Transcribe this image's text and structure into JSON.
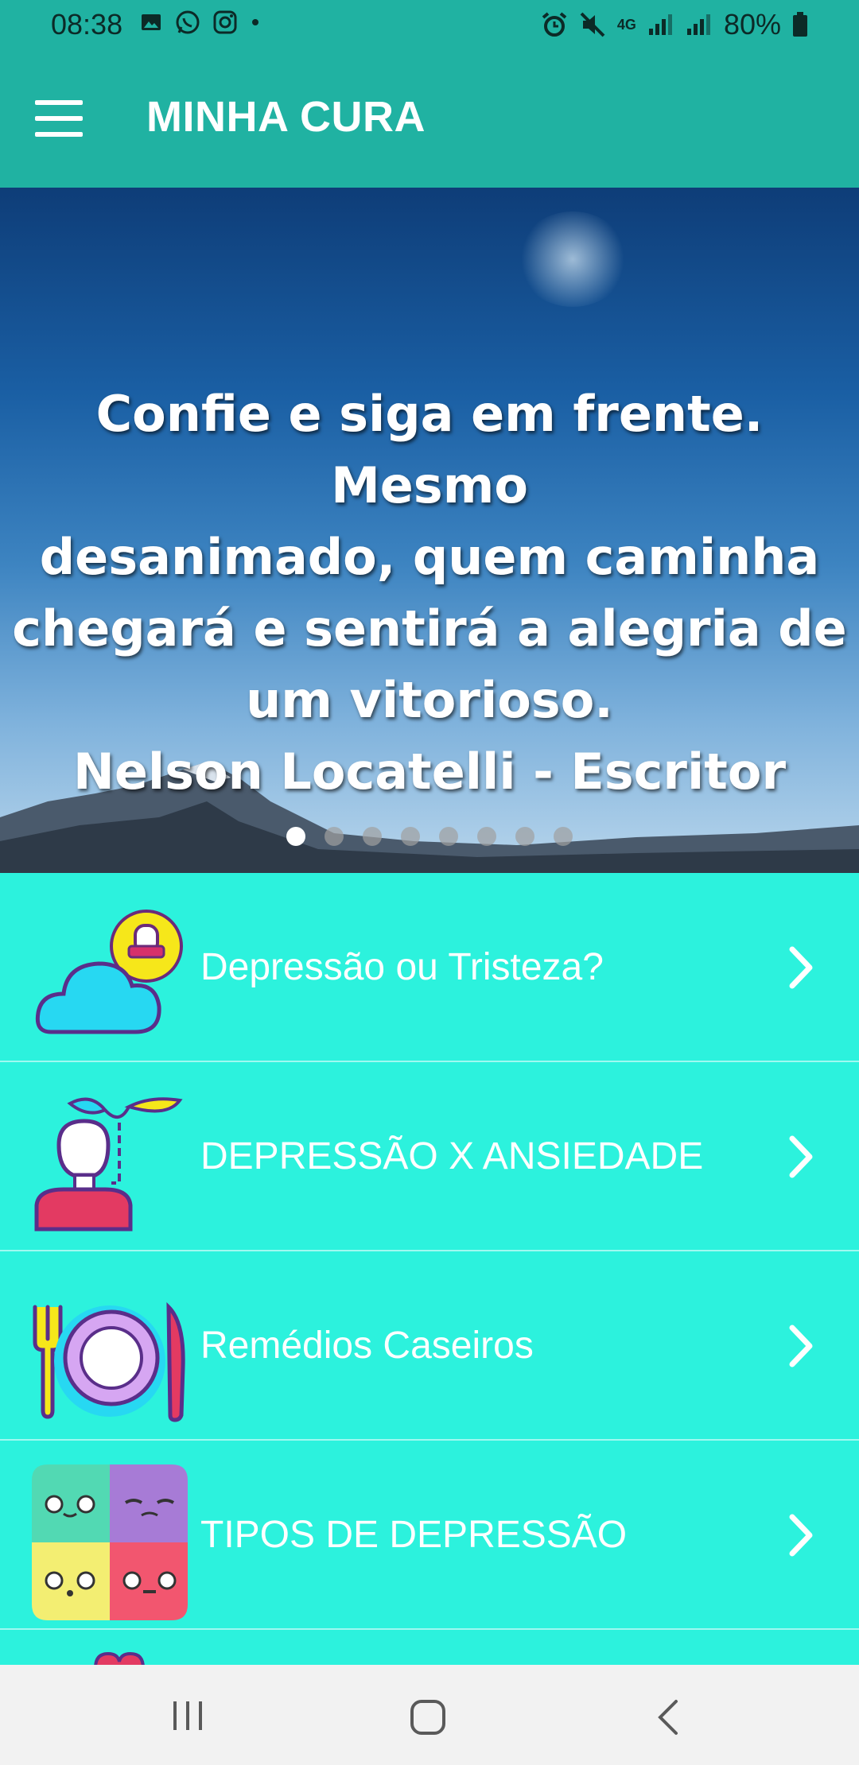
{
  "status_bar": {
    "time": "08:38",
    "battery": "80%",
    "network": "4G"
  },
  "app_bar": {
    "title": "MINHA CURA"
  },
  "banner": {
    "quote_lines": [
      "Confie e siga em frente. Mesmo",
      "desanimado, quem caminha",
      "chegará e sentirá a alegria de",
      "um vitorioso.",
      "Nelson Locatelli - Escritor"
    ],
    "page_count": 8,
    "active_page": 1
  },
  "menu_items": [
    {
      "label": "Depressão ou Tristeza?",
      "icon": "cloud-sun-icon"
    },
    {
      "label": "DEPRESSÃO X ANSIEDADE",
      "icon": "person-plant-icon"
    },
    {
      "label": "Remédios Caseiros",
      "icon": "plate-cutlery-icon"
    },
    {
      "label": "TIPOS DE DEPRESSÃO",
      "icon": "emoji-faces-icon"
    }
  ],
  "colors": {
    "primary": "#20b2a2",
    "list_bg": "#2cf2dd",
    "text": "#ffffff"
  }
}
